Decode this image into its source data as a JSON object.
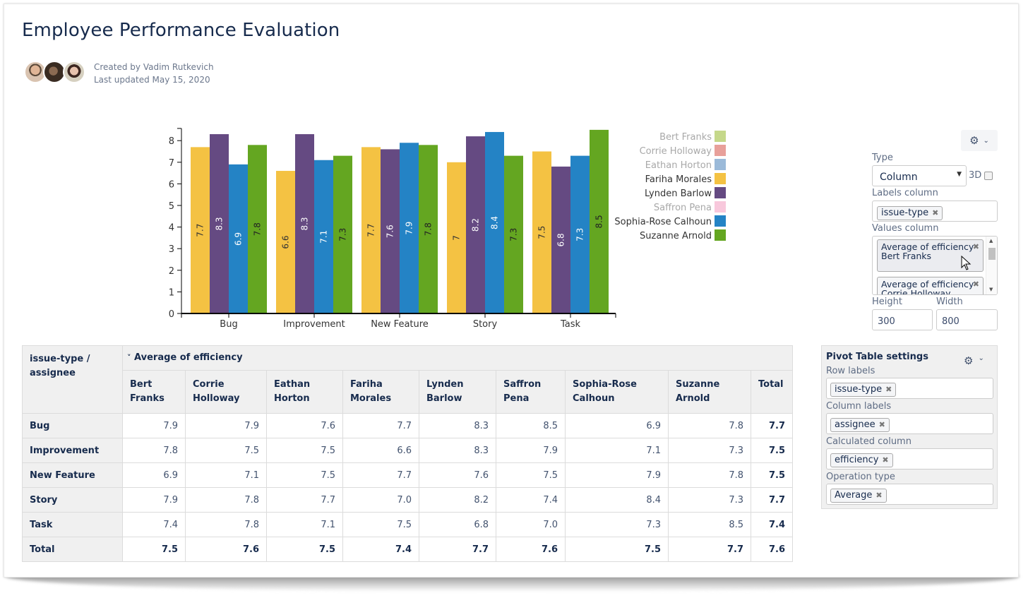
{
  "page": {
    "title": "Employee Performance Evaluation",
    "created_by": "Created by Vadim Rutkevich",
    "last_updated": "Last updated May 15, 2020",
    "avatars": [
      {
        "name": "avatar-1",
        "color": "#c89a7a"
      },
      {
        "name": "avatar-2",
        "color": "#5a4636"
      },
      {
        "name": "avatar-3",
        "color": "#b88a72"
      }
    ]
  },
  "chart_settings": {
    "type_label": "Type",
    "type_value": "Column",
    "three_d_label": "3D",
    "three_d_checked": false,
    "labels_column_label": "Labels column",
    "labels_column_tags": [
      "issue-type"
    ],
    "values_column_label": "Values column",
    "values_column_tags": [
      "Average of efficiency Bert Franks",
      "Average of efficiency Corrie Holloway"
    ],
    "height_label": "Height",
    "height_value": "300",
    "width_label": "Width",
    "width_value": "800"
  },
  "chart_data": {
    "type": "bar",
    "title": "",
    "xlabel": "",
    "ylabel": "",
    "ylim": [
      0,
      8.5
    ],
    "yticks": [
      0,
      1,
      2,
      3,
      4,
      5,
      6,
      7,
      8
    ],
    "grid": false,
    "legend_position": "right",
    "categories": [
      "Bug",
      "Improvement",
      "New Feature",
      "Story",
      "Task"
    ],
    "legend": [
      {
        "name": "Bert Franks",
        "color": "#c5d88a",
        "visible": false
      },
      {
        "name": "Corrie Holloway",
        "color": "#e8a09a",
        "visible": false
      },
      {
        "name": "Eathan Horton",
        "color": "#9bbad9",
        "visible": false
      },
      {
        "name": "Fariha Morales",
        "color": "#f4c243",
        "visible": true
      },
      {
        "name": "Lynden Barlow",
        "color": "#654a82",
        "visible": true
      },
      {
        "name": "Saffron Pena",
        "color": "#f8c8dc",
        "visible": false
      },
      {
        "name": "Sophia-Rose Calhoun",
        "color": "#2483c5",
        "visible": true
      },
      {
        "name": "Suzanne Arnold",
        "color": "#64a621",
        "visible": true
      }
    ],
    "series": [
      {
        "name": "Fariha Morales",
        "color": "#f4c243",
        "label_color": "#333333",
        "values": [
          7.7,
          6.6,
          7.7,
          7,
          7.5
        ]
      },
      {
        "name": "Lynden Barlow",
        "color": "#654a82",
        "label_color": "#ffffff",
        "values": [
          8.3,
          8.3,
          7.6,
          8.2,
          6.8
        ]
      },
      {
        "name": "Sophia-Rose Calhoun",
        "color": "#2483c5",
        "label_color": "#ffffff",
        "values": [
          6.9,
          7.1,
          7.9,
          8.4,
          7.3
        ]
      },
      {
        "name": "Suzanne Arnold",
        "color": "#64a621",
        "label_color": "#222222",
        "values": [
          7.8,
          7.3,
          7.8,
          7.3,
          8.5
        ]
      }
    ]
  },
  "pivot_table": {
    "corner_header": "issue-type / assignee",
    "group_header": "Average of efficiency",
    "columns": [
      "Bert Franks",
      "Corrie Holloway",
      "Eathan Horton",
      "Fariha Morales",
      "Lynden Barlow",
      "Saffron Pena",
      "Sophia-Rose Calhoun",
      "Suzanne Arnold",
      "Total"
    ],
    "rows": [
      {
        "label": "Bug",
        "values": [
          "7.9",
          "7.9",
          "7.6",
          "7.7",
          "8.3",
          "8.5",
          "6.9",
          "7.8",
          "7.7"
        ]
      },
      {
        "label": "Improvement",
        "values": [
          "7.8",
          "7.5",
          "7.5",
          "6.6",
          "8.3",
          "7.9",
          "7.1",
          "7.3",
          "7.5"
        ]
      },
      {
        "label": "New Feature",
        "values": [
          "6.9",
          "7.1",
          "7.5",
          "7.7",
          "7.6",
          "7.5",
          "7.9",
          "7.8",
          "7.5"
        ]
      },
      {
        "label": "Story",
        "values": [
          "7.9",
          "7.8",
          "7.7",
          "7.0",
          "8.2",
          "7.4",
          "8.4",
          "7.3",
          "7.7"
        ]
      },
      {
        "label": "Task",
        "values": [
          "7.4",
          "7.8",
          "7.1",
          "7.5",
          "6.8",
          "7.0",
          "7.3",
          "8.5",
          "7.4"
        ]
      },
      {
        "label": "Total",
        "values": [
          "7.5",
          "7.6",
          "7.5",
          "7.4",
          "7.7",
          "7.6",
          "7.5",
          "7.7",
          "7.6"
        ]
      }
    ]
  },
  "pivot_settings": {
    "title": "Pivot Table settings",
    "row_labels_label": "Row labels",
    "row_labels_tags": [
      "issue-type"
    ],
    "column_labels_label": "Column labels",
    "column_labels_tags": [
      "assignee"
    ],
    "calculated_column_label": "Calculated column",
    "calculated_column_tags": [
      "efficiency"
    ],
    "operation_type_label": "Operation type",
    "operation_type_tags": [
      "Average"
    ]
  },
  "icons": {
    "gear": "⚙",
    "chevron_down": "⌄",
    "remove": "✖",
    "select_caret": "▼",
    "scroll_up": "▲",
    "scroll_down": "▼",
    "collapse": "˅"
  }
}
